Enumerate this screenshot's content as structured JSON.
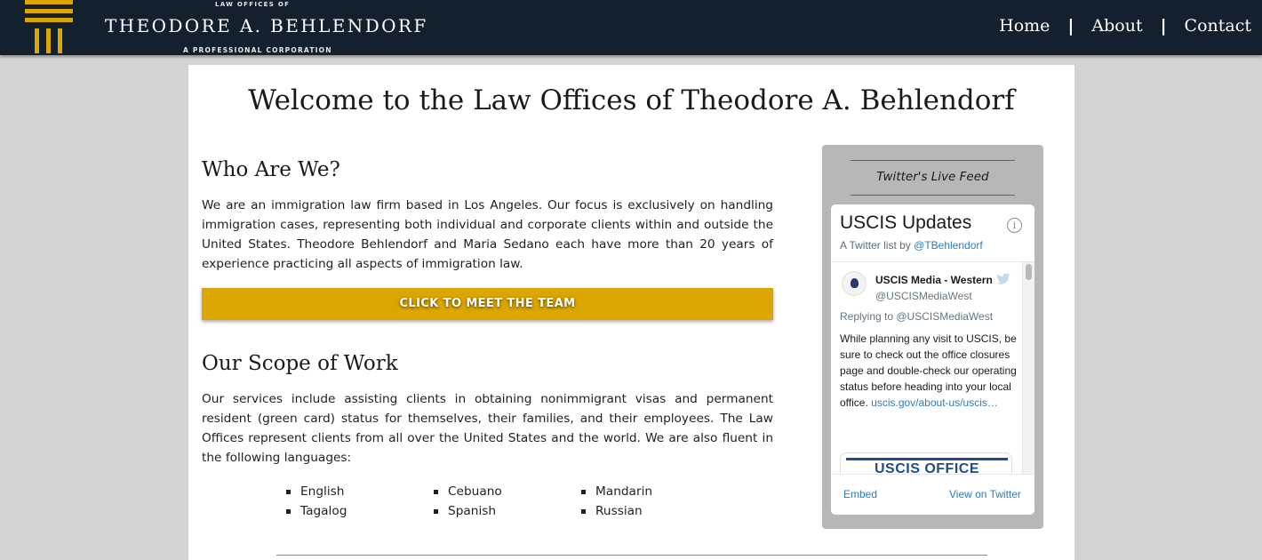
{
  "header": {
    "logo_top_text": "LAW OFFICES OF",
    "logo_name": "THEODORE A. BEHLENDORF",
    "logo_corp_text": "A PROFESSIONAL CORPORATION",
    "nav": [
      {
        "label": "Home"
      },
      {
        "label": "About"
      },
      {
        "label": "Contact"
      }
    ],
    "nav_separator": "|"
  },
  "main": {
    "title": "Welcome to the Law Offices of Theodore A. Behlendorf",
    "who": {
      "heading": "Who Are We?",
      "body": "We are an immigration law firm based in Los Angeles. Our focus is exclusively on handling immigration cases, representing both individual and corporate clients within and outside the United States. Theodore Behlendorf and Maria Sedano each have more than 20 years of experience practicing all aspects of immigration law."
    },
    "meet_button_label": "CLICK TO MEET THE TEAM",
    "scope": {
      "heading": "Our Scope of Work",
      "body": "Our services include assisting clients in obtaining nonimmigrant visas and permanent resident (green card) status for themselves, their families, and their employees. The Law Offices represent clients from all over the United States and the world. We are also fluent in the following languages:"
    },
    "languages": [
      [
        "English",
        "Tagalog"
      ],
      [
        "Cebuano",
        "Spanish"
      ],
      [
        "Mandarin",
        "Russian"
      ]
    ]
  },
  "twitter": {
    "caption": "Twitter's Live Feed",
    "list_title": "USCIS Updates",
    "info_icon": "info-icon",
    "list_by_prefix": "A Twitter list by ",
    "list_by_handle": "@TBehlendorf",
    "tweet": {
      "author": "USCIS Media - Western",
      "handle": "@USCISMediaWest",
      "reply_line": "Replying to @USCISMediaWest",
      "text": "While planning any visit to USCIS, be sure to check out the office closures page and double-check our operating status before heading into your local office. ",
      "link_text": "uscis.gov/about-us/uscis…",
      "media_text": "USCIS OFFICE"
    },
    "footer": {
      "embed": "Embed",
      "view_on_twitter": "View on Twitter"
    }
  },
  "colors": {
    "header_bg": "#13202e",
    "logo_gold": "#dca500",
    "button_gold": "#dca500",
    "page_bg": "#d3d3d3",
    "twitter_link": "#2b7bb9"
  }
}
